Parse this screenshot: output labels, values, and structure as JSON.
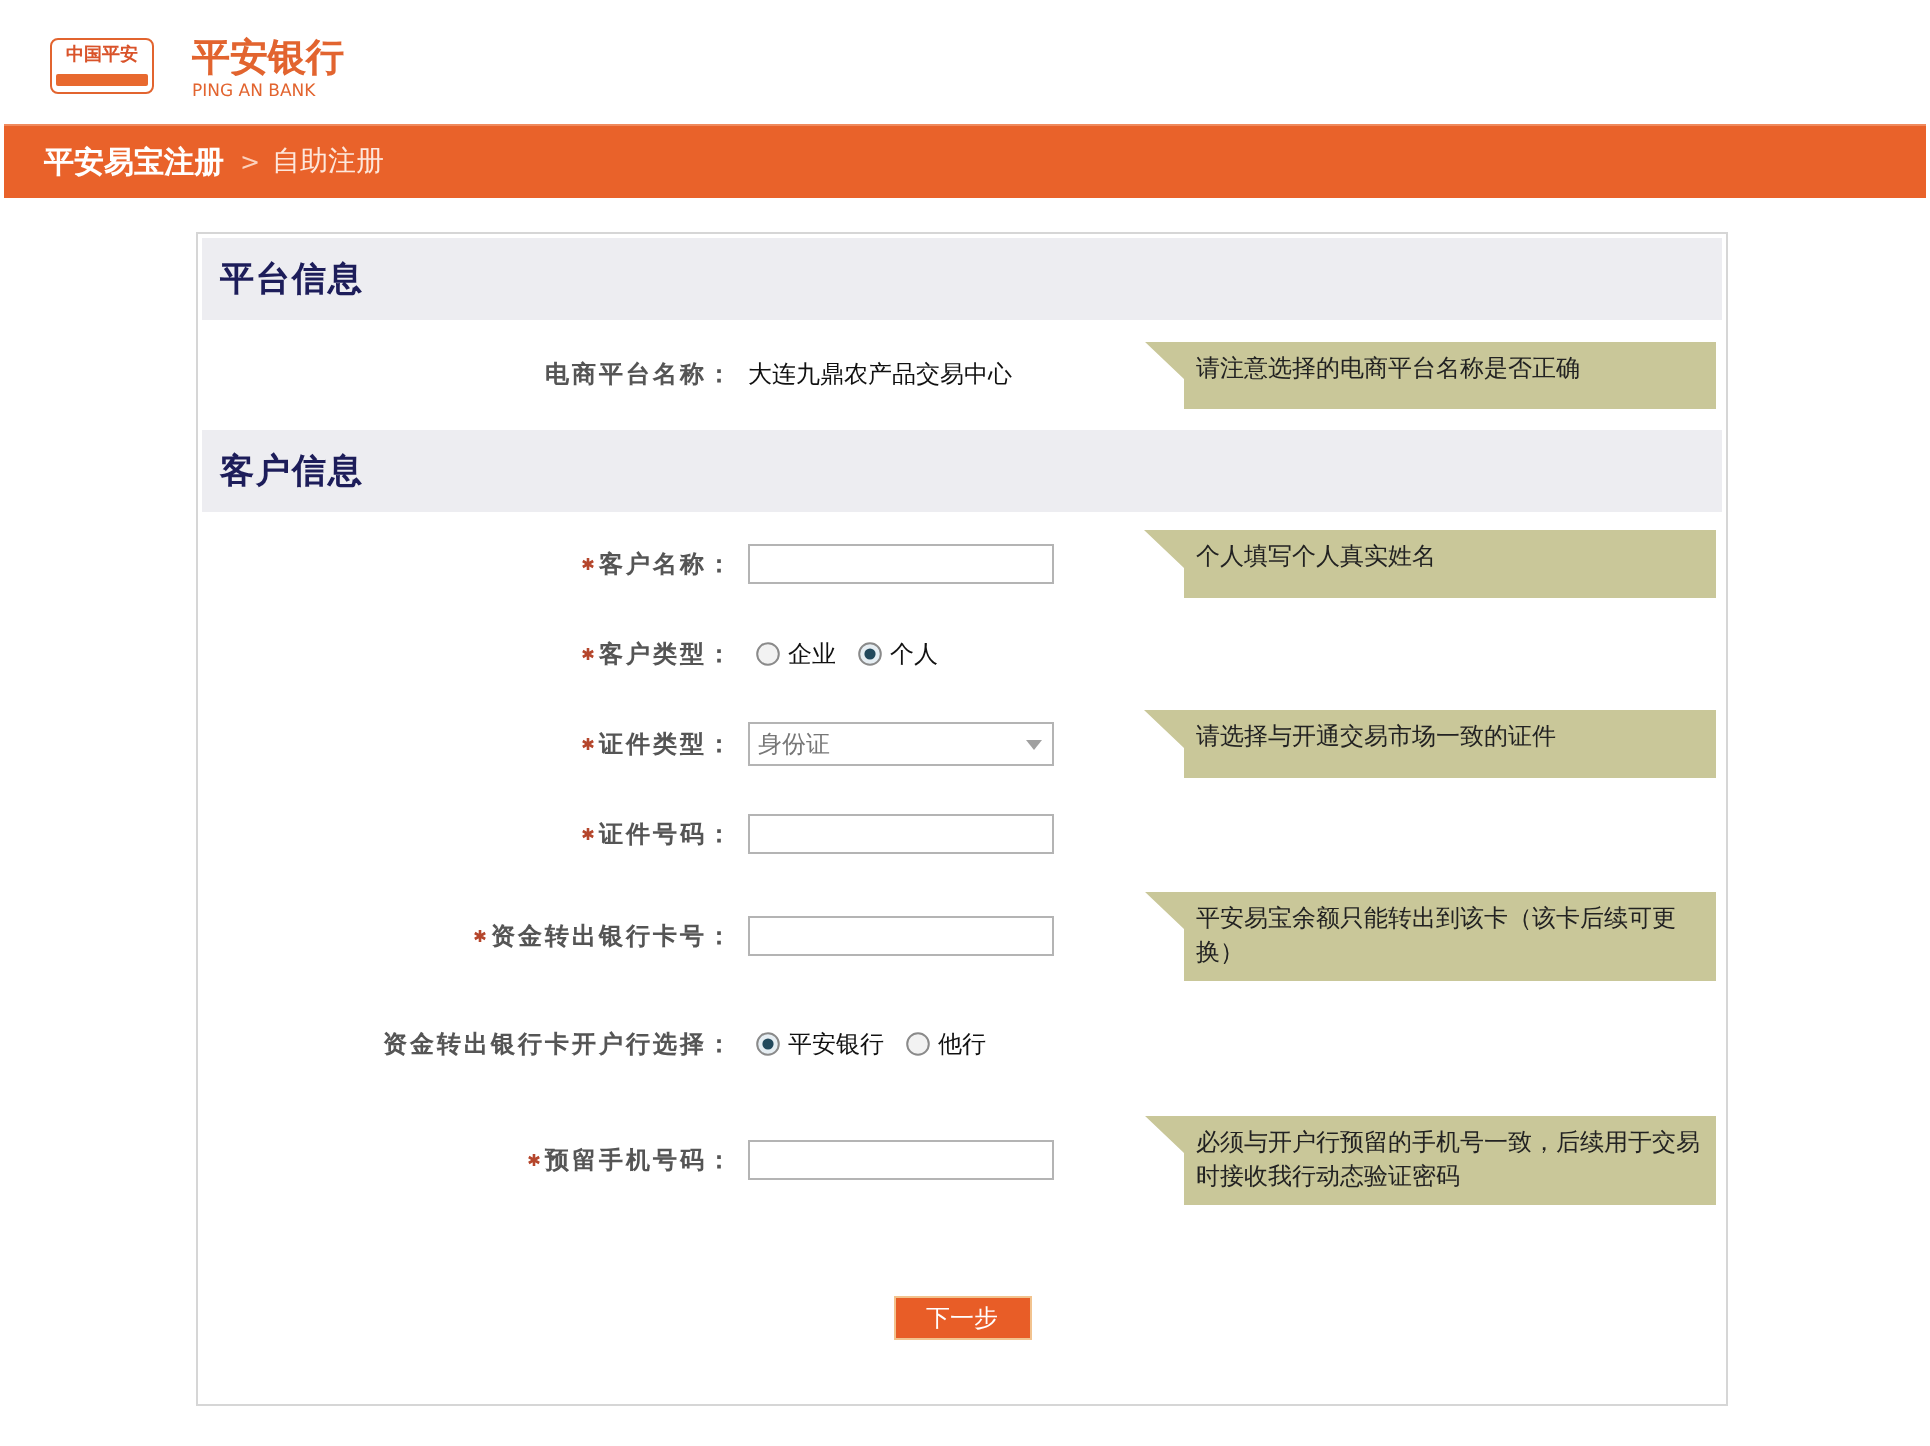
{
  "logo": {
    "emblem_text": "中国平安",
    "name": "平安银行",
    "name_en": "PING AN BANK"
  },
  "breadcrumb": {
    "separator": ">",
    "items": [
      {
        "label": "平安易宝注册",
        "current": false
      },
      {
        "label": "自助注册",
        "current": true
      }
    ]
  },
  "sections": [
    {
      "title": "平台信息",
      "fields": [
        {
          "kind": "static",
          "label": "电商平台名称：",
          "required": false,
          "value": "大连九鼎农产品交易中心",
          "tip": "请注意选择的电商平台名称是否正确"
        }
      ]
    },
    {
      "title": "客户信息",
      "fields": [
        {
          "kind": "text",
          "label": "客户名称：",
          "required": true,
          "tip": "个人填写个人真实姓名"
        },
        {
          "kind": "radio",
          "label": "客户类型：",
          "required": true,
          "options": [
            {
              "label": "企业",
              "selected": false
            },
            {
              "label": "个人",
              "selected": true
            }
          ]
        },
        {
          "kind": "select",
          "label": "证件类型：",
          "required": true,
          "value": "身份证",
          "tip": "请选择与开通交易市场一致的证件"
        },
        {
          "kind": "text",
          "label": "证件号码：",
          "required": true
        },
        {
          "kind": "text",
          "label": "资金转出银行卡号：",
          "required": true,
          "tip": "平安易宝余额只能转出到该卡（该卡后续可更换）"
        },
        {
          "kind": "radio",
          "label": "资金转出银行卡开户行选择：",
          "required": false,
          "options": [
            {
              "label": "平安银行",
              "selected": true
            },
            {
              "label": "他行",
              "selected": false
            }
          ]
        },
        {
          "kind": "text",
          "label": "预留手机号码：",
          "required": true,
          "tip": "必须与开户行预留的手机号一致，后续用于交易时接收我行动态验证密码"
        }
      ]
    }
  ],
  "submit": "下一步"
}
